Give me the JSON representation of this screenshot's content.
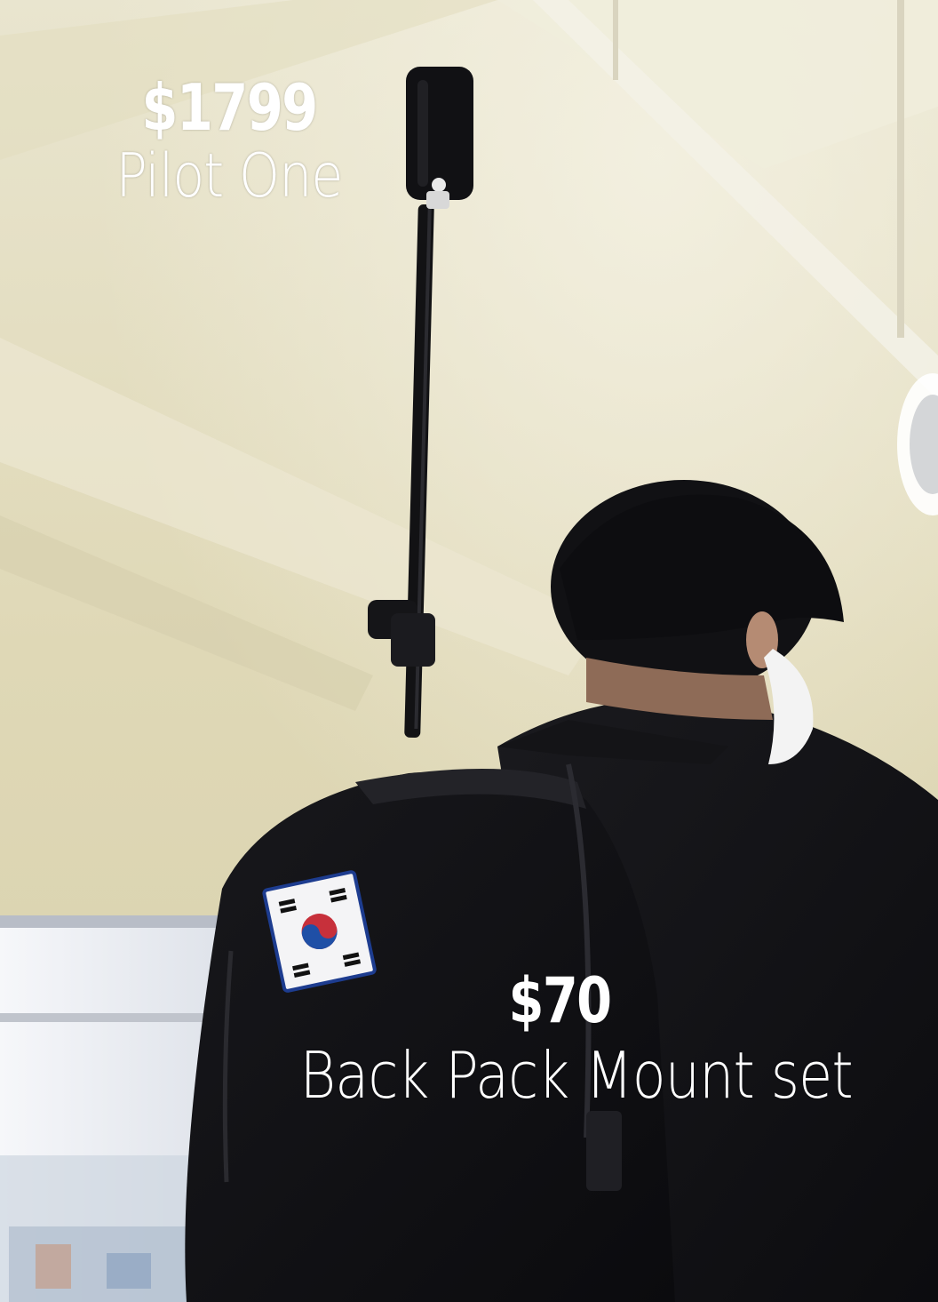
{
  "products": [
    {
      "price": "$1799",
      "name": "Pilot One"
    },
    {
      "price": "$70",
      "name": "Back Pack Mount set"
    }
  ],
  "colors": {
    "text": "#ffffff",
    "ceiling": "#e6e0c3",
    "dark": "#111113"
  }
}
